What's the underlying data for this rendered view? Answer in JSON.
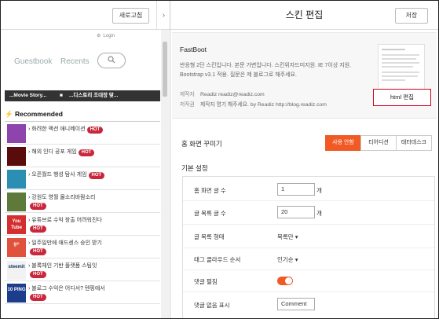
{
  "left": {
    "refresh_label": "새로고침",
    "collapse_glyph": "›",
    "login_label": "Login",
    "nav": {
      "guestbook": "Guestbook",
      "recents": "Recents"
    },
    "darkbar": {
      "left": "...Movie Story...",
      "right": "...디스토리 조대장 맞..."
    },
    "recommended_title": "Recommended",
    "hot_label": "HOT",
    "items": [
      {
        "title": "› 화려한 액션 애니메이션",
        "hot_inline": true,
        "thumb_color": "#8e44ad",
        "thumb_icon": "game-thumbnail-icon"
      },
      {
        "title": "› 해외 인디 공포 게임",
        "hot_inline": true,
        "thumb_color": "#5a0b0b",
        "thumb_icon": "horror-thumbnail-icon"
      },
      {
        "title": "› 오픈월드 행성 탐사 게임",
        "hot_inline": true,
        "thumb_color": "#2a8fb2",
        "thumb_icon": "planet-thumbnail-icon"
      },
      {
        "title": "› 강원도 영월 물소리바람소리",
        "hot_inline": false,
        "thumb_color": "#5d7a3b",
        "thumb_icon": "landscape-thumbnail-icon"
      },
      {
        "title": "› 유튜브로 수익 창출 어려워진다",
        "hot_inline": false,
        "thumb_color": "#d32f2f",
        "thumb_icon": "youtube-thumbnail-icon",
        "thumb_text": "You Tube"
      },
      {
        "title": "› 일주일만에 애드센스 승인 받기",
        "hot_inline": false,
        "thumb_color": "#e0523c",
        "thumb_icon": "google-plus-thumbnail-icon",
        "thumb_text": "g+"
      },
      {
        "title": "› 블록체인 기반 플랫폼 스팀잇",
        "hot_inline": false,
        "thumb_color": "#f2f2f2",
        "thumb_icon": "steemit-thumbnail-icon",
        "thumb_text": "steemit"
      },
      {
        "title": "› 블로그 수익은 어디서? 텐핑에서",
        "hot_inline": false,
        "thumb_color": "#1c3c8c",
        "thumb_icon": "tenping-thumbnail-icon",
        "thumb_text": "10 PING"
      }
    ]
  },
  "right": {
    "title": "스킨 편집",
    "save_label": "저장",
    "skin": {
      "name": "FastBoot",
      "desc": "반응형 2단 스킨입니다. 본문 가변입니다. 스킨위자드미지원. IE 7이상 지원. Bootstrap v3.1 적용. 질문은 제 블로그로 해주세요.",
      "maker_label": "제작자",
      "maker_value": "Readiz  readiz@readiz.com",
      "copyright_label": "저작권",
      "copyright_value": "제작자 명기 해주세요. by Readiz http://blog.readiz.com",
      "html_edit_label": "html 편집"
    },
    "home_section_title": "홈 화면 꾸미기",
    "toggles": [
      "사용 안함",
      "티어디션",
      "태터데스크"
    ],
    "active_toggle": 0,
    "basic_title": "기본 설정",
    "settings": [
      {
        "label": "홈 화면 글 수",
        "type": "input",
        "value": "1",
        "unit": "개"
      },
      {
        "label": "글 목록 글 수",
        "type": "input",
        "value": "20",
        "unit": "개"
      },
      {
        "label": "글 목록 형태",
        "type": "select",
        "value": "목록만 ▾"
      },
      {
        "label": "태그 클라우드 순서",
        "type": "select",
        "value": "인기순 ▾"
      },
      {
        "label": "댓글 펼침",
        "type": "switch",
        "value": "on"
      },
      {
        "label": "댓글 없음 표시",
        "type": "selectbox",
        "value": "Comment"
      }
    ],
    "accent_color": "#f15a24"
  }
}
